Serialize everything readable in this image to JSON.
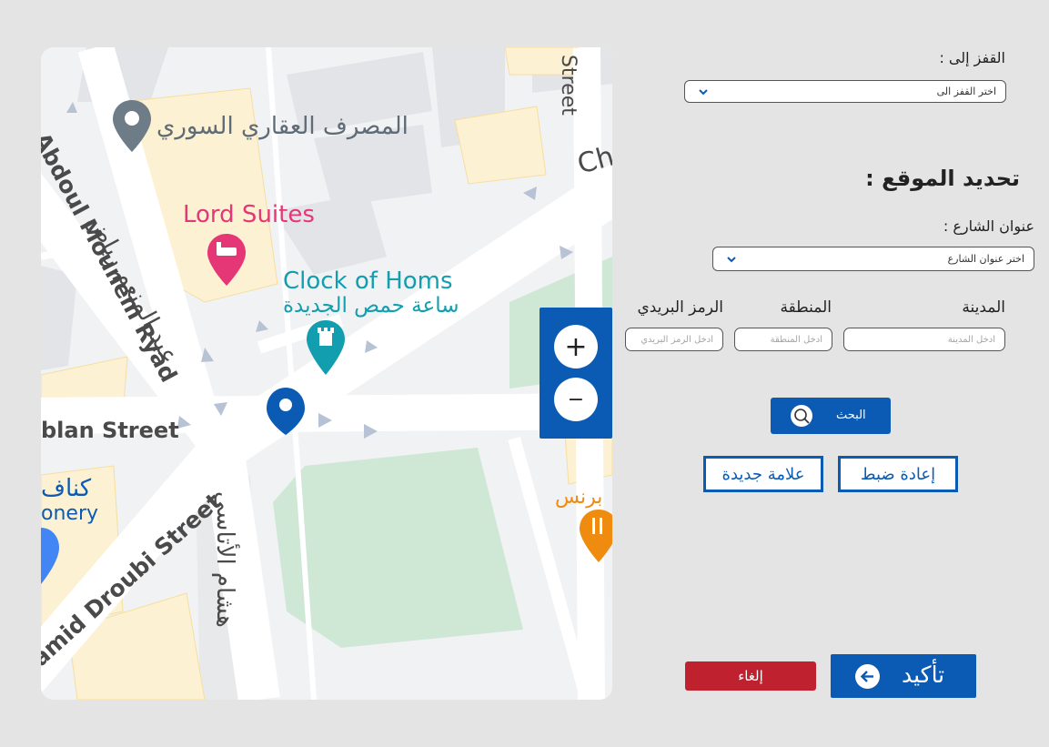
{
  "map": {
    "labels": {
      "bank": "المصرف العقاري السوري",
      "street_vertical": "Street",
      "ch_partial": "Ch",
      "abdoul_en": "Abdoul Mounem Ryad",
      "abdoul_ar": "عبد المنعم رياض",
      "lord_suites": "Lord Suites",
      "clock_en": "Clock of Homs",
      "clock_ar": "ساعة حمص الجديدة",
      "blan_street": "blan Street",
      "knafeh_ar": "كناف",
      "onery": "onery",
      "droubi": "Hamid Droubi Street",
      "hisham_ar": "هشام الأتاسي",
      "restaurant_ar": "برنس"
    },
    "zoom_in_label": "+",
    "zoom_out_label": "−"
  },
  "form": {
    "jump_label": "القفز إلى :",
    "jump_select": "اختر القفز الى",
    "section_title": "تحديد الموقع :",
    "street_label": "عنوان الشارع :",
    "street_select": "اختر عنوان الشارع",
    "city_label": "المدينة",
    "city_placeholder": "ادخل المدينة",
    "area_label": "المنطقة",
    "area_placeholder": "ادخل المنطقة",
    "postal_label": "الرمز البريدي",
    "postal_placeholder": "ادخل الرمز البريدي",
    "search_button": "البحث",
    "reset_button": "إعادة ضبط",
    "new_marker_button": "علامة جديدة",
    "cancel_button": "إلغاء",
    "confirm_button": "تأكيد"
  },
  "colors": {
    "primary": "#0b5bb5",
    "danger": "#c0212e",
    "park": "#cfe8d5",
    "building": "#e3e4e7",
    "highlight_block": "#fdf1d3",
    "marker_gray": "#6e7c87",
    "hotel_pink": "#e53775",
    "clock_teal": "#129eaf",
    "restaurant_orange": "#ef8c10"
  }
}
